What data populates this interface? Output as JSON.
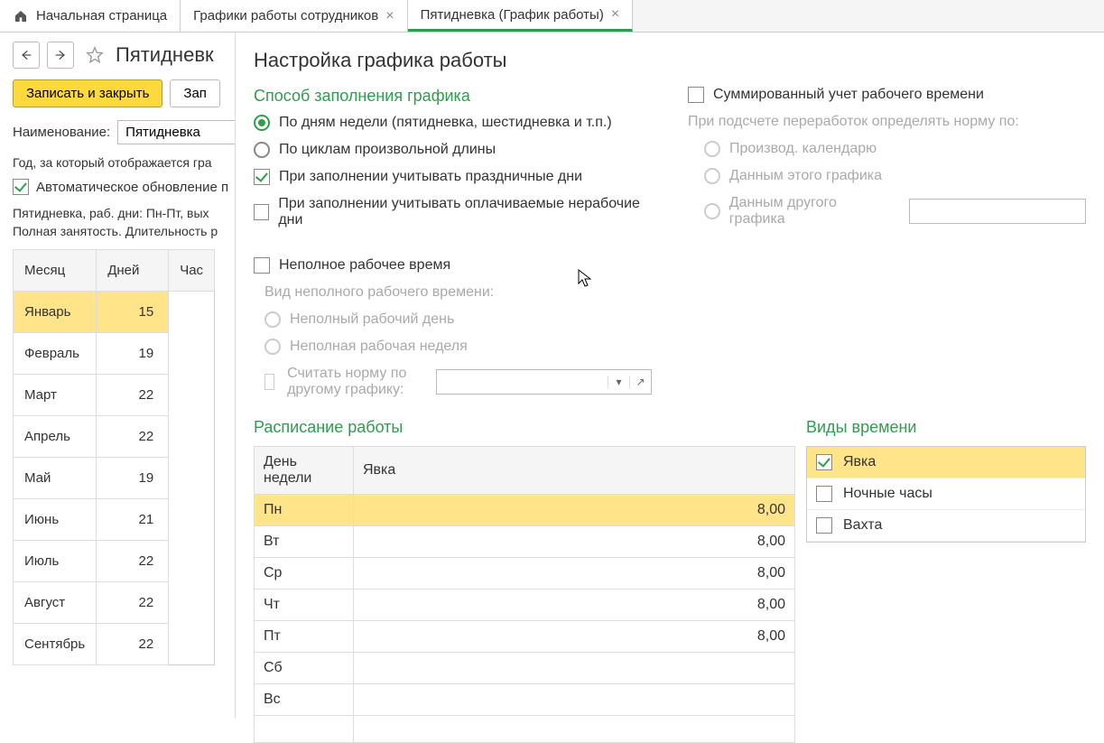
{
  "tabs": {
    "home": "Начальная страница",
    "list": "Графики работы сотрудников",
    "current": "Пятидневка (График работы)"
  },
  "page": {
    "title_truncated": "Пятидневк",
    "save_close": "Записать и закрыть",
    "save": "Зап",
    "name_label": "Наименование:",
    "name_value": "Пятидневка",
    "year_label_truncated": "Год, за который отображается гра",
    "auto_update_truncated": "Автоматическое обновление п",
    "summary_line1": "Пятидневка, раб. дни: Пн-Пт, вых",
    "summary_line2": "Полная занятость. Длительность р"
  },
  "month_table": {
    "col_month": "Месяц",
    "col_days": "Дней",
    "col_hours": "Час",
    "rows": [
      {
        "month": "Январь",
        "days": "15",
        "selected": true
      },
      {
        "month": "Февраль",
        "days": "19"
      },
      {
        "month": "Март",
        "days": "22"
      },
      {
        "month": "Апрель",
        "days": "22"
      },
      {
        "month": "Май",
        "days": "19"
      },
      {
        "month": "Июнь",
        "days": "21"
      },
      {
        "month": "Июль",
        "days": "22"
      },
      {
        "month": "Август",
        "days": "22"
      },
      {
        "month": "Сентябрь",
        "days": "22"
      }
    ]
  },
  "overlay": {
    "title": "Настройка графика работы",
    "fill_method_title": "Способ заполнения графика",
    "opt_by_weekday": "По дням недели (пятидневка, шестидневка и т.п.)",
    "opt_by_cycle": "По циклам произвольной длины",
    "opt_holidays": "При заполнении учитывать праздничные дни",
    "opt_paid_nonwork": "При заполнении учитывать оплачиваемые нерабочие дни",
    "opt_summed": "Суммированный учет рабочего времени",
    "norm_label": "При подсчете переработок определять норму по:",
    "norm_calendar": "Производ. календарю",
    "norm_this": "Данным этого графика",
    "norm_other": "Данным другого графика",
    "opt_parttime": "Неполное рабочее время",
    "parttime_kind": "Вид неполного рабочего времени:",
    "parttime_day": "Неполный рабочий день",
    "parttime_week": "Неполная рабочая неделя",
    "opt_other_norm": "Считать норму по другому графику:",
    "schedule_title": "Расписание работы",
    "col_day": "День недели",
    "col_att": "Явка",
    "days": [
      {
        "d": "Пн",
        "v": "8,00",
        "selected": true
      },
      {
        "d": "Вт",
        "v": "8,00"
      },
      {
        "d": "Ср",
        "v": "8,00"
      },
      {
        "d": "Чт",
        "v": "8,00"
      },
      {
        "d": "Пт",
        "v": "8,00"
      },
      {
        "d": "Сб",
        "v": ""
      },
      {
        "d": "Вс",
        "v": ""
      }
    ],
    "time_types_title": "Виды времени",
    "time_types": [
      {
        "label": "Явка",
        "checked": true,
        "selected": true
      },
      {
        "label": "Ночные часы",
        "checked": false
      },
      {
        "label": "Вахта",
        "checked": false
      }
    ]
  }
}
